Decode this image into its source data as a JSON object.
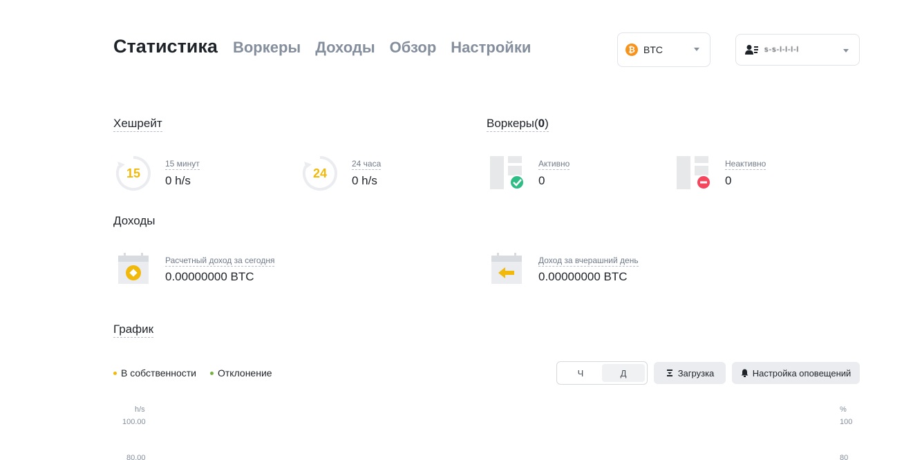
{
  "nav": {
    "active": "Статистика",
    "tabs": [
      "Воркеры",
      "Доходы",
      "Обзор",
      "Настройки"
    ]
  },
  "coin_select": {
    "icon": "bitcoin-icon",
    "label": "BTC"
  },
  "account_select": {
    "icon": "user-icon",
    "name": "s-s-l-l-l-l"
  },
  "hashrate": {
    "title": "Хешрейт",
    "m15": {
      "badge": "15",
      "label": "15 минут",
      "value": "0 h/s"
    },
    "h24": {
      "badge": "24",
      "label": "24 часа",
      "value": "0 h/s"
    }
  },
  "workers": {
    "title_prefix": "Воркеры(",
    "count": "0",
    "title_suffix": ")",
    "active": {
      "label": "Активно",
      "value": "0"
    },
    "inactive": {
      "label": "Неактивно",
      "value": "0"
    }
  },
  "earnings": {
    "title": "Доходы",
    "today": {
      "label": "Расчетный доход за сегодня",
      "value": "0.00000000 BTC"
    },
    "yesterday": {
      "label": "Доход за вчерашний день",
      "value": "0.00000000 BTC"
    }
  },
  "chart": {
    "title": "График",
    "legend": [
      {
        "label": "В собственности",
        "color": "#f0b90b"
      },
      {
        "label": "Отклонение",
        "color": "#76b041"
      }
    ],
    "toggle": {
      "hour": "Ч",
      "day": "Д"
    },
    "download": "Загрузка",
    "alerts": "Настройка оповещений",
    "left_unit": "h/s",
    "right_unit": "%",
    "left_ticks": [
      "100.00",
      "80.00"
    ],
    "right_ticks": [
      "100",
      "80"
    ]
  },
  "colors": {
    "accent": "#f0b90b",
    "success": "#2ebd85",
    "danger": "#f6465d",
    "muted": "#848e9c"
  }
}
